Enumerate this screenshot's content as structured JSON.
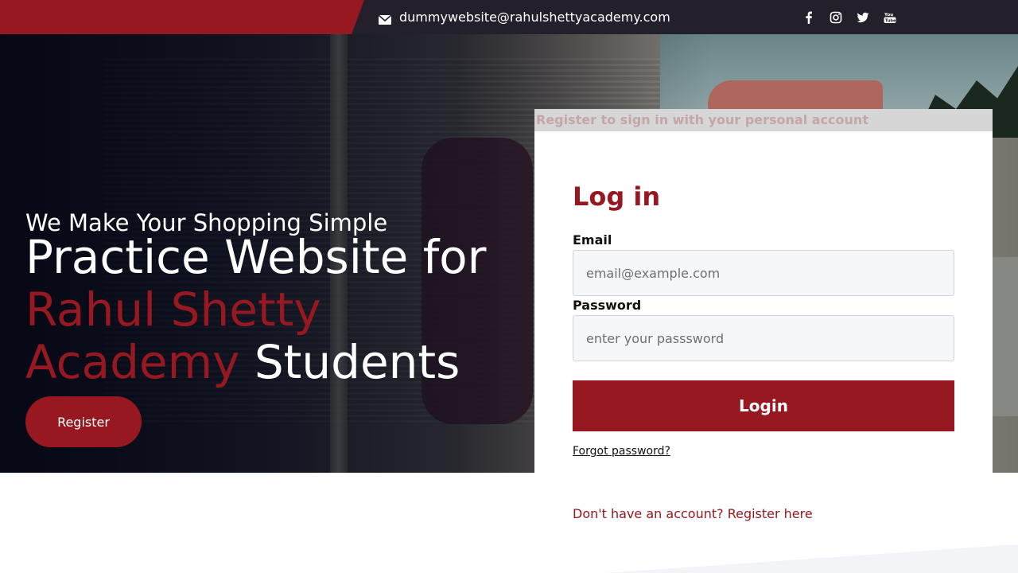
{
  "topbar": {
    "email": "dummywebsite@rahulshettyacademy.com",
    "social_icons": [
      "facebook-icon",
      "instagram-icon",
      "twitter-icon",
      "youtube-icon"
    ],
    "left_color": "#971820",
    "bar_color": "#23202c"
  },
  "hero": {
    "tagline": "We Make Your Shopping Simple",
    "headline_line1": "Practice Website for",
    "headline_accent": "Rahul Shetty Academy",
    "headline_end": "Students",
    "register_button": "Register"
  },
  "login": {
    "banner": "Register to sign in with your personal account",
    "title": "Log in",
    "email_label": "Email",
    "email_placeholder": "email@example.com",
    "email_value": "",
    "password_label": "Password",
    "password_placeholder": "enter your passsword",
    "password_value": "",
    "login_button": "Login",
    "forgot_link": "Forgot password?",
    "register_link": "Don't have an account? Register here"
  },
  "colors": {
    "accent": "#971820",
    "field_bg": "#f6f7f9"
  }
}
